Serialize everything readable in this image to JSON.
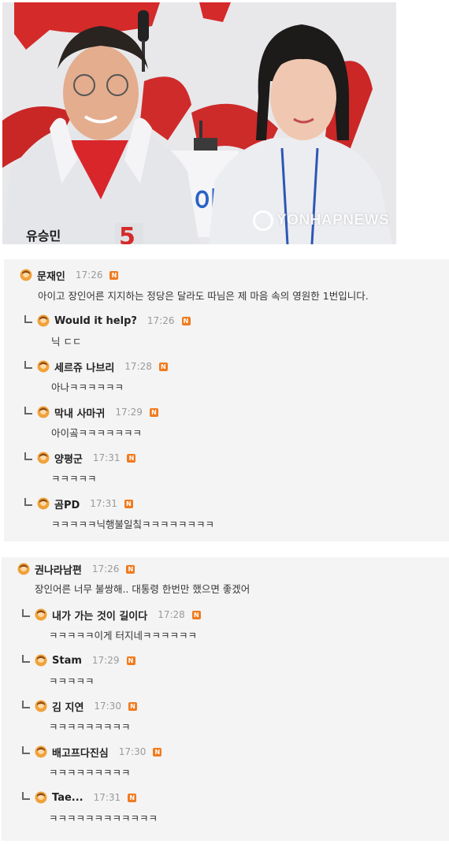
{
  "photo": {
    "watermark": "YONHAPNEWS",
    "badge_number": "5",
    "backdrop_text": "이"
  },
  "colors": {
    "badge": "#f07b1f",
    "box": "#f4f4f4",
    "time": "#9a9a9a"
  },
  "threads": [
    {
      "nick": "문재인",
      "time": "17:26",
      "text": "아이고 장인어른 지지하는 정당은 달라도 따님은 제 마음 속의 영원한 1번입니다.",
      "replies": [
        {
          "nick": "Would it help?",
          "time": "17:26",
          "text": "닉 ㄷㄷ"
        },
        {
          "nick": "세르쥬 나브리",
          "time": "17:28",
          "text": "아나ㅋㅋㅋㅋㅋㅋ"
        },
        {
          "nick": "막내 사마귀",
          "time": "17:29",
          "text": "아이곸ㅋㅋㅋㅋㅋㅋㅋ"
        },
        {
          "nick": "양평군",
          "time": "17:31",
          "text": "ㅋㅋㅋㅋㅋ"
        },
        {
          "nick": "곰PD",
          "time": "17:31",
          "text": "ㅋㅋㅋㅋㅋ닉행불일칰ㅋㅋㅋㅋㅋㅋㅋㅋ"
        }
      ]
    },
    {
      "nick": "권나라남편",
      "time": "17:26",
      "text": "장인어른 너무 불쌍해.. 대통령 한번만 했으면 좋겠어",
      "replies": [
        {
          "nick": "내가 가는 것이 길이다",
          "time": "17:28",
          "text": "ㅋㅋㅋㅋㅋ이게 터지네ㅋㅋㅋㅋㅋㅋ"
        },
        {
          "nick": "Stam",
          "time": "17:29",
          "text": "ㅋㅋㅋㅋㅋ"
        },
        {
          "nick": "김 지연",
          "time": "17:30",
          "text": "ㅋㅋㅋㅋㅋㅋㅋㅋㅋ"
        },
        {
          "nick": "배고프다진심",
          "time": "17:30",
          "text": "ㅋㅋㅋㅋㅋㅋㅋㅋㅋ"
        },
        {
          "nick": "Tae...",
          "time": "17:31",
          "text": "ㅋㅋㅋㅋㅋㅋㅋㅋㅋㅋㅋㅋ"
        }
      ]
    }
  ],
  "new_badge": "N"
}
